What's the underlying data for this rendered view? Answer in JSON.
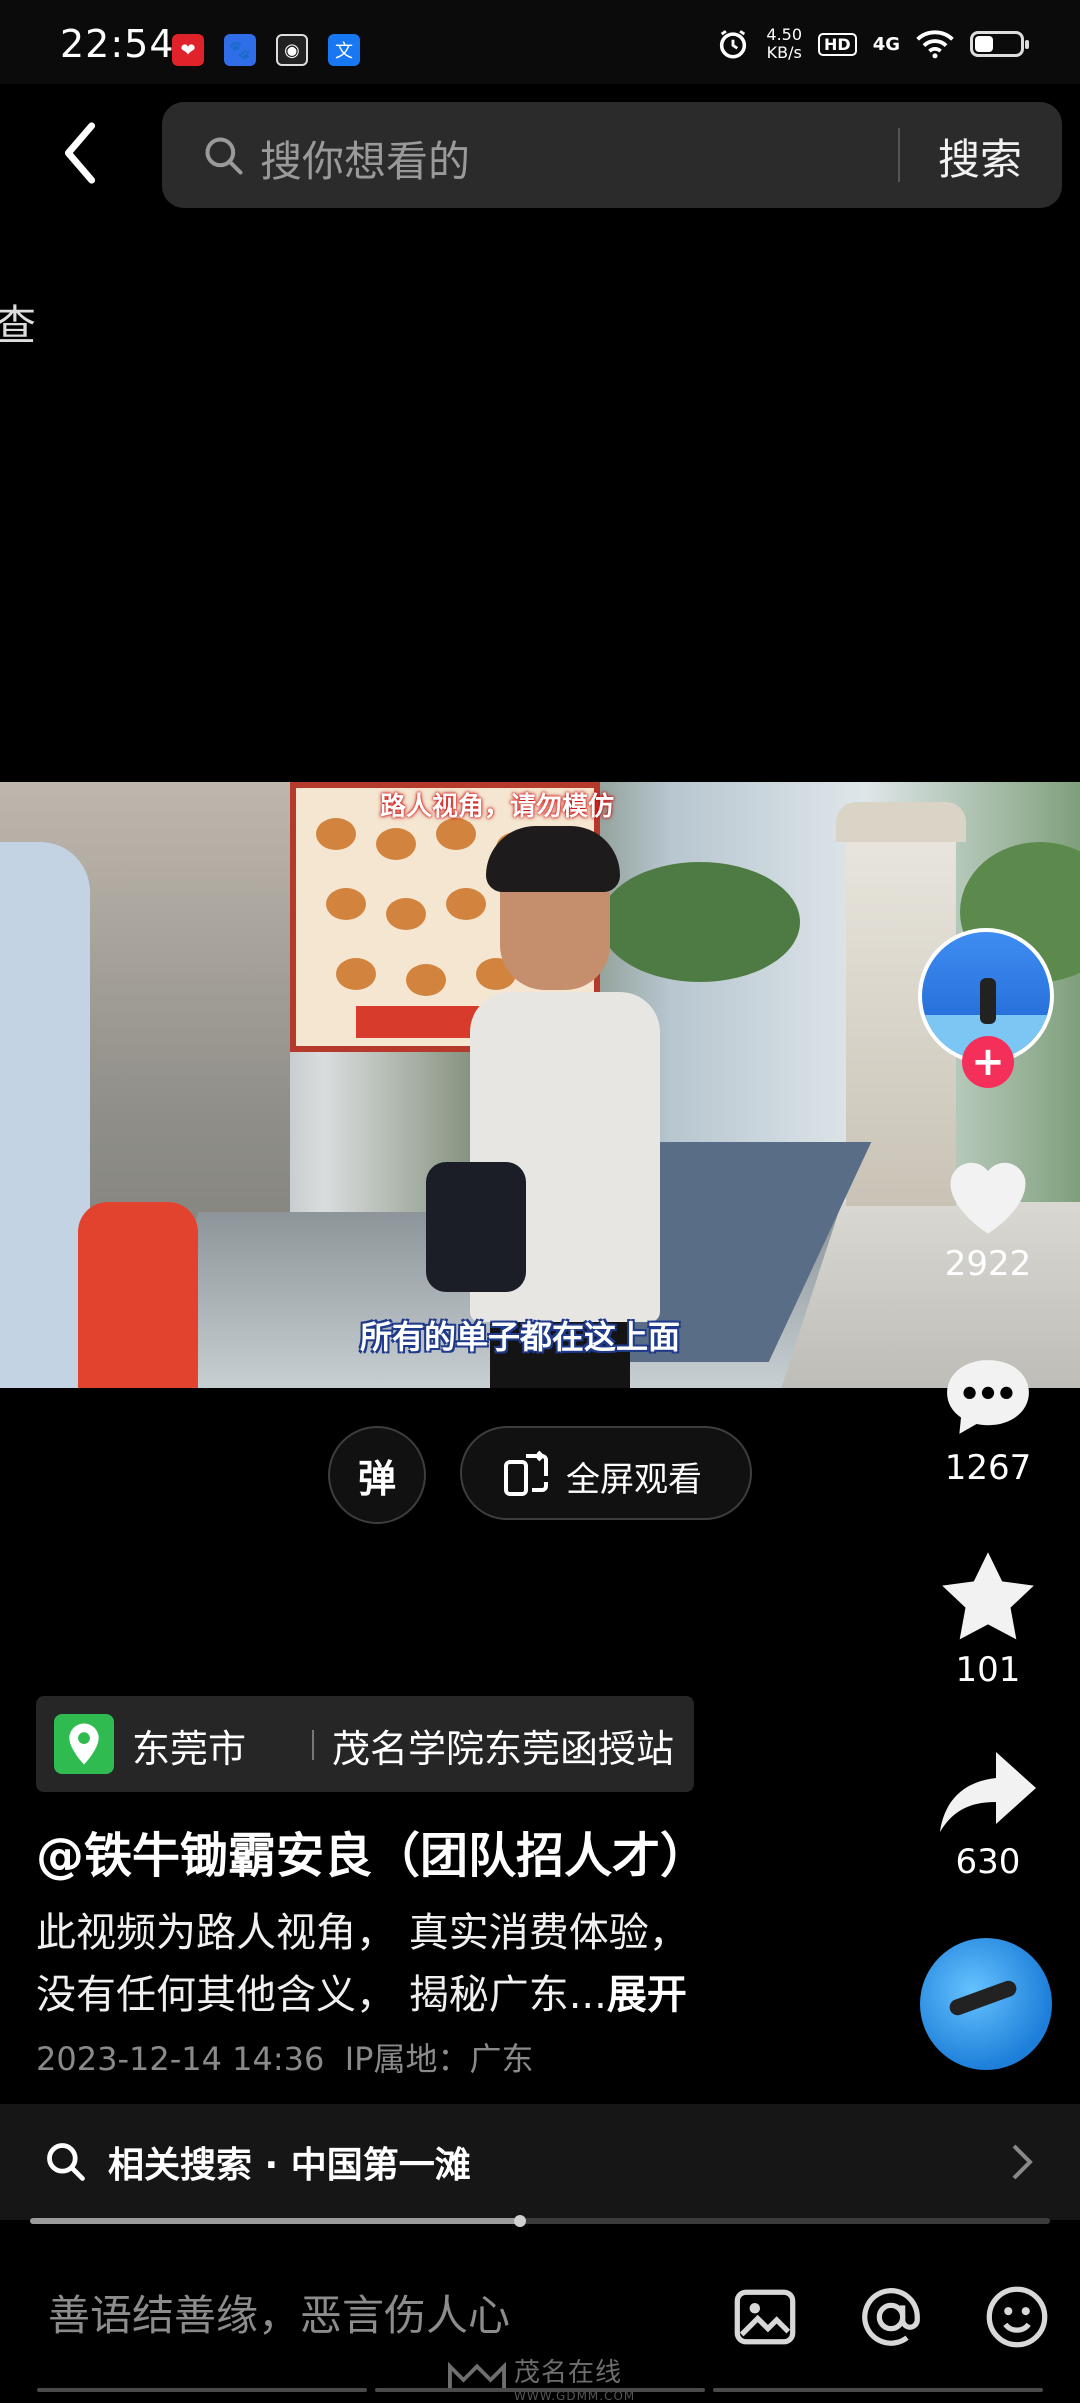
{
  "status_bar": {
    "time": "22:54",
    "speed_value": "4.50",
    "speed_unit": "KB/s",
    "hd": "HD",
    "network": "4G",
    "battery_percent": 45
  },
  "search": {
    "placeholder": "搜你想看的",
    "button": "搜索"
  },
  "edge_text": "查",
  "video": {
    "caption_top": "路人视角，请勿模仿",
    "caption": "所有的单子都在这上面"
  },
  "actions": {
    "likes": "2922",
    "comments": "1267",
    "favorites": "101",
    "shares": "630",
    "follow_label": "+"
  },
  "controls": {
    "danmu": "弹",
    "fullscreen": "全屏观看"
  },
  "location": {
    "city": "东莞市",
    "place": "茂名学院东莞函授站"
  },
  "post": {
    "author": "@铁牛锄霸安良（团队招人才）",
    "desc_line1": "此视频为路人视角， 真实消费体验，",
    "desc_line2": "没有任何其他含义， 揭秘广东...",
    "expand": "展开",
    "datetime": "2023-12-14 14:36",
    "ip": "IP属地：广东"
  },
  "related": {
    "label": "相关搜索 · 中国第一滩"
  },
  "progress": {
    "played_fraction": 0.48
  },
  "comment_bar": {
    "placeholder": "善语结善缘，恶言伤人心"
  },
  "watermark": {
    "text": "茂名在线",
    "sub": "WWW.GDMM.COM"
  },
  "colors": {
    "accent_red": "#f4305a",
    "location_green": "#2fbb4f"
  }
}
